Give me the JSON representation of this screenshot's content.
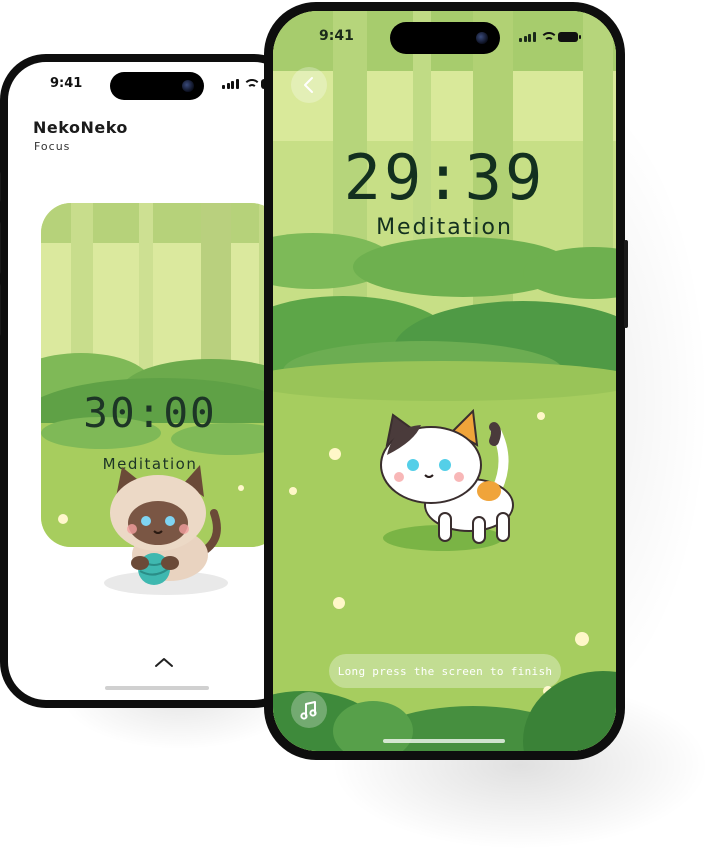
{
  "status_bar": {
    "time": "9:41"
  },
  "back_screen": {
    "brand": "NekoNeko",
    "subtitle": "Focus",
    "card": {
      "timer": "30:00",
      "mode": "Meditation"
    }
  },
  "front_screen": {
    "timer": "29:39",
    "mode": "Meditation",
    "hint": "Long press the screen to finish"
  },
  "icons": {
    "back": "chevron-left-icon",
    "music": "music-note-icon",
    "expand": "chevron-up-icon"
  },
  "colors": {
    "forest_light": "#d6e79a",
    "grass": "#a9cf61",
    "dark_green_text": "#13301f",
    "bush_dark": "#4f9a45"
  }
}
